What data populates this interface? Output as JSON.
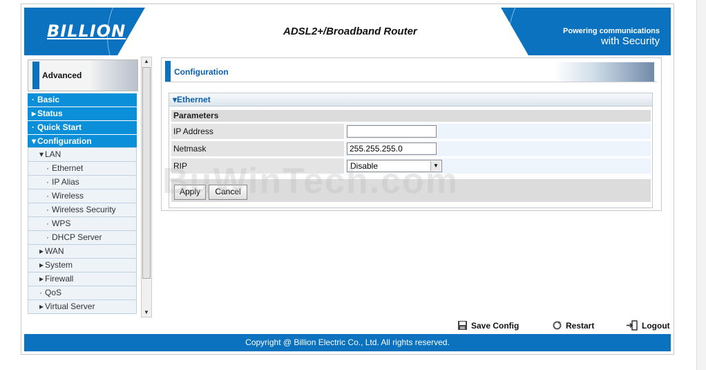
{
  "header": {
    "logo": "BILLION",
    "title": "ADSL2+/Broadband Router",
    "tagline_line1": "Powering communications",
    "tagline_line2": "with Security"
  },
  "sidebar": {
    "section_label": "Advanced",
    "items": [
      {
        "label": "Basic",
        "prefix": "·"
      },
      {
        "label": "Status",
        "prefix": "▸"
      },
      {
        "label": "Quick Start",
        "prefix": "·"
      },
      {
        "label": "Configuration",
        "prefix": "▾"
      },
      {
        "label": "LAN",
        "prefix": "▾"
      },
      {
        "label": "Ethernet",
        "prefix": "·"
      },
      {
        "label": "IP Alias",
        "prefix": "·"
      },
      {
        "label": "Wireless",
        "prefix": "·"
      },
      {
        "label": "Wireless Security",
        "prefix": "·"
      },
      {
        "label": "WPS",
        "prefix": "·"
      },
      {
        "label": "DHCP Server",
        "prefix": "·"
      },
      {
        "label": "WAN",
        "prefix": "▸"
      },
      {
        "label": "System",
        "prefix": "▸"
      },
      {
        "label": "Firewall",
        "prefix": "▸"
      },
      {
        "label": "QoS",
        "prefix": "·"
      },
      {
        "label": "Virtual Server",
        "prefix": "▸"
      }
    ]
  },
  "main": {
    "page_title": "Configuration",
    "panel_title": "▾Ethernet",
    "params_heading": "Parameters",
    "ip_label": "IP Address",
    "ip_value": "",
    "netmask_label": "Netmask",
    "netmask_value": "255.255.255.0",
    "rip_label": "RIP",
    "rip_value": "Disable",
    "apply_label": "Apply",
    "cancel_label": "Cancel"
  },
  "actions": {
    "save": "Save Config",
    "restart": "Restart",
    "logout": "Logout"
  },
  "footer": {
    "copyright": "Copyright @ Billion Electric Co., Ltd. All rights reserved."
  },
  "watermark": "BuWinTech.com",
  "colors": {
    "accent": "#0a72bf",
    "menu": "#0b8fd8"
  }
}
